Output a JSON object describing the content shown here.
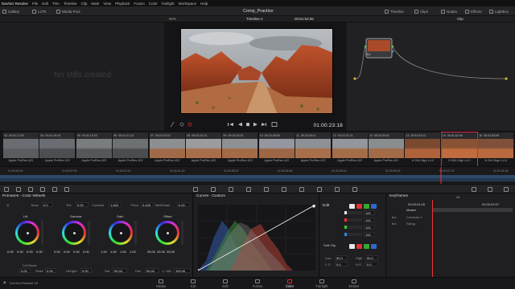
{
  "menubar": {
    "items": [
      "DaVinci Resolve",
      "File",
      "Edit",
      "Trim",
      "Timeline",
      "Clip",
      "Mark",
      "View",
      "Playback",
      "Fusion",
      "Color",
      "Fairlight",
      "Workspace",
      "Help"
    ]
  },
  "toolbar": {
    "gallery": "Gallery",
    "luts": "LUTs",
    "media_pool": "Media Pool",
    "project_title": "Comp_Practice",
    "timeline": "Timeline",
    "clips": "Clips",
    "nodes": "Nodes",
    "effects": "Effects",
    "lightbox": "Lightbox"
  },
  "viewer_header": {
    "zoom": "60%",
    "timeline_name": "Timeline 2",
    "timecode": "00:51:52:06",
    "mode": "Clip"
  },
  "gallery": {
    "empty_message": "No stills created"
  },
  "viewer": {
    "timecode": "01:00:23:18"
  },
  "nodes": {
    "node_label": "01"
  },
  "clips": [
    {
      "num": "03",
      "tc": "00:41:17:00",
      "label": "Apple ProRes 422"
    },
    {
      "num": "04",
      "tc": "00:41:18:14",
      "label": "Apple ProRes 422"
    },
    {
      "num": "05",
      "tc": "00:41:19:20",
      "label": "Apple ProRes 422"
    },
    {
      "num": "06",
      "tc": "00:41:21:13",
      "label": "Apple ProRes 422"
    },
    {
      "num": "07",
      "tc": "09:23:23:02",
      "label": "Apple ProRes 422"
    },
    {
      "num": "08",
      "tc": "09:23:24:14",
      "label": "Apple ProRes 422"
    },
    {
      "num": "09",
      "tc": "09:23:25:20",
      "label": "Apple ProRes 422"
    },
    {
      "num": "10",
      "tc": "09:23:28:00",
      "label": "Apple ProRes 422"
    },
    {
      "num": "11",
      "tc": "09:23:30:11",
      "label": "Apple ProRes 422"
    },
    {
      "num": "12",
      "tc": "09:23:31:21",
      "label": "Apple ProRes 422"
    },
    {
      "num": "13",
      "tc": "09:23:33:02",
      "label": "Apple ProRes 422"
    },
    {
      "num": "14",
      "tc": "00:51:51:01",
      "label": "H.264 High L4.0"
    },
    {
      "num": "15",
      "tc": "00:51:52:06",
      "label": "H.264 High L4.0"
    },
    {
      "num": "16",
      "tc": "00:51:53:09",
      "label": "H.264 High L4.0"
    }
  ],
  "mini_timeline": {
    "ticks": [
      "01:00:00:00",
      "01:00:07:09",
      "01:00:14:13",
      "01:00:21:16",
      "01:00:28:22",
      "01:00:36:04",
      "01:00:43:14",
      "01:00:50:09",
      "01:00:57:12",
      "01:01:04:18"
    ]
  },
  "primaries": {
    "title": "Primaries - Color Wheels",
    "temp_label": "Temp",
    "temp": "0.0",
    "tint_label": "Tint",
    "tint": "0.00",
    "contrast_label": "Contrast",
    "contrast": "1.000",
    "pivot_label": "Pivot",
    "pivot": "0.435",
    "middetail_label": "Mid/Detail",
    "middetail": "0.00",
    "wheels": [
      {
        "name": "Lift",
        "vals": [
          "0.00",
          "0.00",
          "0.00",
          "0.00"
        ]
      },
      {
        "name": "Gamma",
        "vals": [
          "0.00",
          "0.00",
          "0.00",
          "0.00"
        ]
      },
      {
        "name": "Gain",
        "vals": [
          "1.00",
          "1.00",
          "1.00",
          "1.00"
        ]
      },
      {
        "name": "Offset",
        "vals": [
          "25.00",
          "25.00",
          "25.00",
          ""
        ]
      }
    ],
    "colboost_label": "Col Boost",
    "colboost": "0.00",
    "shad_label": "Shad",
    "shad": "0.00",
    "hilight_label": "Hi/Light",
    "hilight": "0.00",
    "sat_label": "Sat",
    "sat": "50.00",
    "hue_label": "Hue",
    "hue": "50.00",
    "lmix_label": "L. Mix",
    "lmix": "100.00"
  },
  "curves": {
    "title": "Curves - Custom"
  },
  "edit": {
    "title": "Edit",
    "values": [
      "100",
      "100",
      "100",
      "100"
    ],
    "softclip_label": "Soft Clip",
    "low_label": "Low",
    "low": "50.0",
    "high_label": "High",
    "high": "50.0",
    "ls_label": "L.S.",
    "ls": "0.0",
    "hs_label": "H.S.",
    "hs": "0.0"
  },
  "keyframes": {
    "title": "Keyframes",
    "filter": "All",
    "tc_start": "00:00:01:05",
    "tc_end": "00:00:02:07",
    "tracks": [
      "Master",
      "Corrector 1",
      "Sizing"
    ]
  },
  "pages": {
    "app_name": "DaVinci Resolve 18",
    "items": [
      "Media",
      "Cut",
      "Edit",
      "Fusion",
      "Color",
      "Fairlight",
      "Deliver"
    ],
    "active": "Color"
  }
}
